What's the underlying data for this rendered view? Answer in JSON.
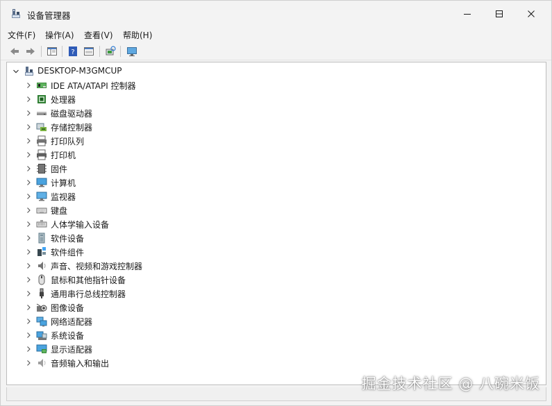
{
  "window": {
    "title": "设备管理器",
    "app_icon": "device-manager-icon",
    "controls": {
      "minimize_icon": "minimize-icon",
      "maximize_icon": "maximize-icon",
      "close_icon": "close-icon"
    }
  },
  "menu": {
    "items": [
      {
        "label": "文件(F)"
      },
      {
        "label": "操作(A)"
      },
      {
        "label": "查看(V)"
      },
      {
        "label": "帮助(H)"
      }
    ]
  },
  "toolbar": {
    "buttons": [
      {
        "icon": "back-arrow-icon"
      },
      {
        "icon": "forward-arrow-icon"
      },
      {
        "icon": "properties-pane-icon"
      },
      {
        "icon": "help-icon"
      },
      {
        "icon": "show-hide-console-tree-icon"
      },
      {
        "icon": "scan-hardware-changes-icon"
      },
      {
        "icon": "monitor-display-icon"
      }
    ]
  },
  "tree": {
    "root_label": "DESKTOP-M3GMCUP",
    "root_icon": "computer-tower-icon",
    "nodes": [
      {
        "label": "IDE ATA/ATAPI 控制器",
        "icon": "ide-controller-icon"
      },
      {
        "label": "处理器",
        "icon": "processor-icon"
      },
      {
        "label": "磁盘驱动器",
        "icon": "disk-drive-icon"
      },
      {
        "label": "存储控制器",
        "icon": "storage-controller-icon"
      },
      {
        "label": "打印队列",
        "icon": "print-queue-icon"
      },
      {
        "label": "打印机",
        "icon": "printer-icon"
      },
      {
        "label": "固件",
        "icon": "firmware-icon"
      },
      {
        "label": "计算机",
        "icon": "computer-icon"
      },
      {
        "label": "监视器",
        "icon": "monitor-icon"
      },
      {
        "label": "键盘",
        "icon": "keyboard-icon"
      },
      {
        "label": "人体学输入设备",
        "icon": "hid-icon"
      },
      {
        "label": "软件设备",
        "icon": "software-device-icon"
      },
      {
        "label": "软件组件",
        "icon": "software-component-icon"
      },
      {
        "label": "声音、视频和游戏控制器",
        "icon": "sound-icon"
      },
      {
        "label": "鼠标和其他指针设备",
        "icon": "mouse-icon"
      },
      {
        "label": "通用串行总线控制器",
        "icon": "usb-icon"
      },
      {
        "label": "图像设备",
        "icon": "camera-icon"
      },
      {
        "label": "网络适配器",
        "icon": "network-adapter-icon"
      },
      {
        "label": "系统设备",
        "icon": "system-device-icon"
      },
      {
        "label": "显示适配器",
        "icon": "display-adapter-icon"
      },
      {
        "label": "音频输入和输出",
        "icon": "audio-io-icon"
      }
    ]
  },
  "watermark": "掘金技术社区 @ 八碗米饭",
  "colors": {
    "accent": "#1f6fd1",
    "window_bg": "#f3f3f3",
    "content_bg": "#ffffff"
  }
}
